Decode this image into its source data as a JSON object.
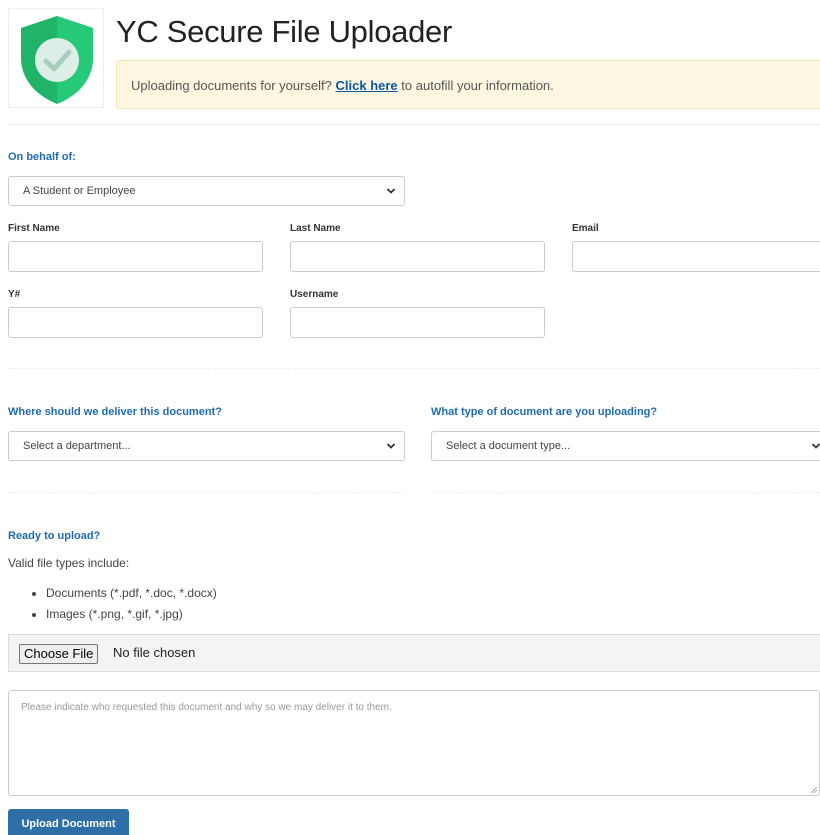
{
  "header": {
    "title": "YC Secure File Uploader",
    "notice_prefix": "Uploading documents for yourself?",
    "notice_link": "Click here",
    "notice_suffix": "to autofill your information."
  },
  "on_behalf": {
    "label": "On behalf of:",
    "selected": "A Student or Employee"
  },
  "fields": {
    "first_name": {
      "label": "First Name",
      "value": ""
    },
    "last_name": {
      "label": "Last Name",
      "value": ""
    },
    "email": {
      "label": "Email",
      "value": ""
    },
    "y_number": {
      "label": "Y#",
      "value": ""
    },
    "username": {
      "label": "Username",
      "value": ""
    }
  },
  "delivery": {
    "department_label": "Where should we deliver this document?",
    "department_selected": "Select a department...",
    "doctype_label": "What type of document are you uploading?",
    "doctype_selected": "Select a document type..."
  },
  "upload": {
    "label": "Ready to upload?",
    "valid_types_text": "Valid file types include:",
    "types": [
      "Documents (*.pdf, *.doc, *.docx)",
      "Images (*.png, *.gif, *.jpg)"
    ],
    "choose_file_label": "Choose File",
    "no_file_text": "No file chosen",
    "notes_placeholder": "Please indicate who requested this document and why so we may deliver it to them.",
    "submit_label": "Upload Document"
  },
  "colors": {
    "accent": "#1f6bb0",
    "button": "#2f6fa8",
    "notice_bg": "#fdf7e1",
    "shield_green": "#2ec27e"
  },
  "icons": {
    "logo": "shield-check-icon",
    "select": "chevron-down-icon"
  }
}
